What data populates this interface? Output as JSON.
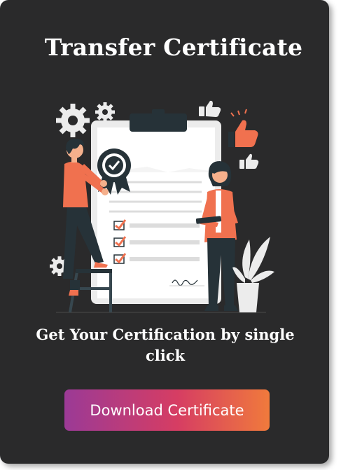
{
  "card": {
    "title": "Transfer Certificate",
    "subtitle": "Get Your Certification by single click",
    "download_label": "Download Certificate"
  },
  "illustration": {
    "name": "certificate-illustration",
    "icons": [
      "gear-icon",
      "gear-icon",
      "gear-icon",
      "thumbs-up-icon",
      "thumbs-up-icon",
      "thumbs-up-icon",
      "award-ribbon-icon",
      "checkbox-icon",
      "plant-icon"
    ],
    "colors": {
      "accent": "#f0714f",
      "dark": "#263238",
      "paper": "#ffffff",
      "background": "#2a2a2b"
    }
  }
}
